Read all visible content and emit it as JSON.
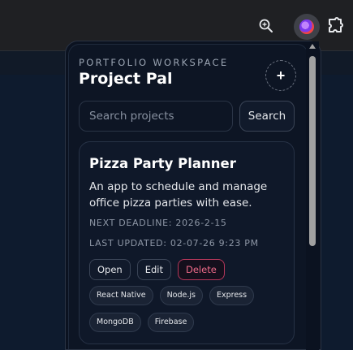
{
  "popup": {
    "workspace_label": "PORTFOLIO WORKSPACE",
    "title": "Project Pal",
    "add_label": "+",
    "search": {
      "placeholder": "Search projects",
      "button_label": "Search"
    }
  },
  "projects": [
    {
      "name": "Pizza Party Planner",
      "description": "An app to schedule and manage office pizza parties with ease.",
      "deadline": "NEXT DEADLINE: 2026-2-15",
      "updated": "LAST UPDATED: 02-07-26 9:23 PM",
      "actions": {
        "open": "Open",
        "edit": "Edit",
        "delete": "Delete"
      },
      "tags": [
        "React Native",
        "Node.js",
        "Express",
        "MongoDB",
        "Firebase"
      ]
    }
  ],
  "colors": {
    "accent_delete": "#ef6b8a",
    "background": "#0d1524"
  },
  "icons": {
    "zoom": "zoom-icon",
    "extension": "extension-avatar-icon",
    "extensions_menu": "puzzle-icon",
    "add": "plus-icon"
  }
}
